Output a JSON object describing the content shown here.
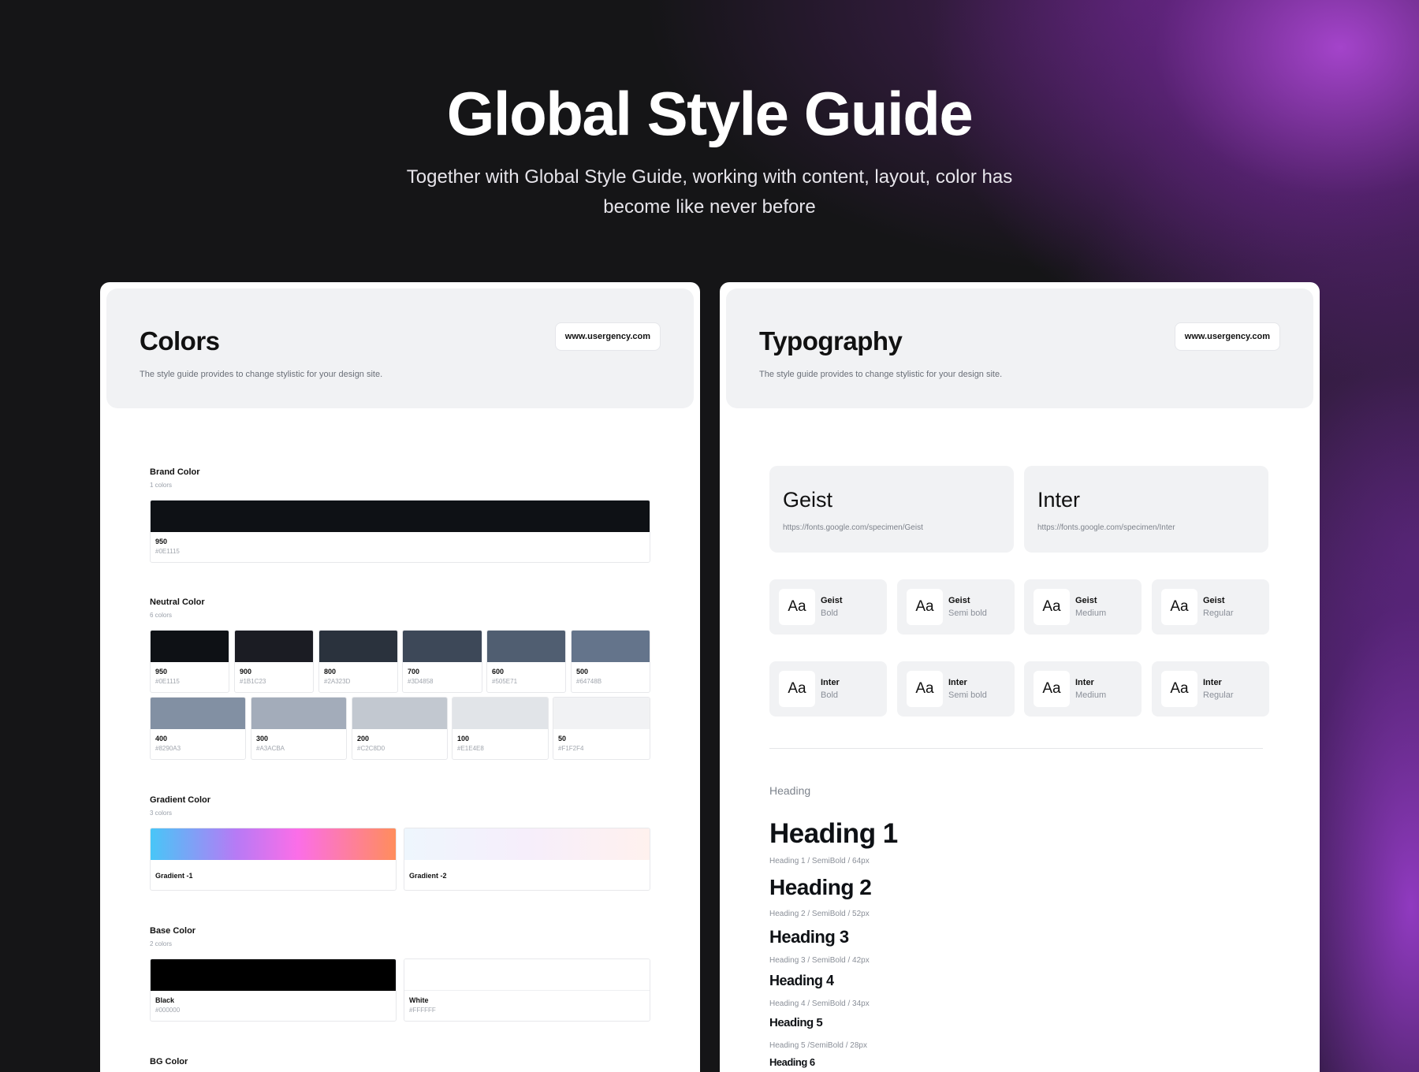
{
  "hero": {
    "title": "Global Style Guide",
    "subtitle": "Together with Global Style Guide, working with content, layout, color has become like never before"
  },
  "colors_panel": {
    "title": "Colors",
    "description": "The style guide provides to change stylistic for your design site.",
    "url_label": "www.usergency.com",
    "brand": {
      "title": "Brand Color",
      "count": "1 colors",
      "swatches": [
        {
          "name": "950",
          "hex": "#0E1115",
          "color": "#0E1115"
        }
      ]
    },
    "neutral": {
      "title": "Neutral Color",
      "count": "6 colors",
      "row1": [
        {
          "name": "950",
          "hex": "#0E1115",
          "color": "#0E1115"
        },
        {
          "name": "900",
          "hex": "#1B1C23",
          "color": "#1B1C23"
        },
        {
          "name": "800",
          "hex": "#2A323D",
          "color": "#2A323D"
        },
        {
          "name": "700",
          "hex": "#3D4858",
          "color": "#3D4858"
        },
        {
          "name": "600",
          "hex": "#505E71",
          "color": "#505E71"
        },
        {
          "name": "500",
          "hex": "#64748B",
          "color": "#64748B"
        }
      ],
      "row2": [
        {
          "name": "400",
          "hex": "#8290A3",
          "color": "#8290A3"
        },
        {
          "name": "300",
          "hex": "#A3ACBA",
          "color": "#A3ACBA"
        },
        {
          "name": "200",
          "hex": "#C2C8D0",
          "color": "#C2C8D0"
        },
        {
          "name": "100",
          "hex": "#E1E4E8",
          "color": "#E1E4E8"
        },
        {
          "name": "50",
          "hex": "#F1F2F4",
          "color": "#F1F2F4"
        }
      ]
    },
    "gradient": {
      "title": "Gradient Color",
      "count": "3 colors",
      "swatches": [
        {
          "name": "Gradient -1",
          "css": "linear-gradient(90deg,#48C6F7 0%,#B77AF5 35%,#FB6EE8 60%,#FF8D5C 100%)"
        },
        {
          "name": "Gradient -2",
          "css": "linear-gradient(90deg,#EEF6FD 0%,#F6EEFB 50%,#FFF1EE 100%)"
        }
      ]
    },
    "base": {
      "title": "Base Color",
      "count": "2 colors",
      "swatches": [
        {
          "name": "Black",
          "hex": "#000000",
          "color": "#000000"
        },
        {
          "name": "White",
          "hex": "#FFFFFF",
          "color": "#FFFFFF"
        }
      ]
    },
    "bg": {
      "title": "BG Color"
    }
  },
  "typography_panel": {
    "title": "Typography",
    "description": "The style guide provides to change stylistic for your design site.",
    "url_label": "www.usergency.com",
    "fonts": [
      {
        "name": "Geist",
        "url": "https://fonts.google.com/specimen/Geist"
      },
      {
        "name": "Inter",
        "url": "https://fonts.google.com/specimen/Inter"
      }
    ],
    "weights_geist": [
      {
        "aa": "Aa",
        "font": "Geist",
        "weight": "Bold"
      },
      {
        "aa": "Aa",
        "font": "Geist",
        "weight": "Semi bold"
      },
      {
        "aa": "Aa",
        "font": "Geist",
        "weight": "Medium"
      },
      {
        "aa": "Aa",
        "font": "Geist",
        "weight": "Regular"
      }
    ],
    "weights_inter": [
      {
        "aa": "Aa",
        "font": "Inter",
        "weight": "Bold"
      },
      {
        "aa": "Aa",
        "font": "Inter",
        "weight": "Semi bold"
      },
      {
        "aa": "Aa",
        "font": "Inter",
        "weight": "Medium"
      },
      {
        "aa": "Aa",
        "font": "Inter",
        "weight": "Regular"
      }
    ],
    "heading_section_label": "Heading",
    "headings": [
      {
        "text": "Heading 1",
        "meta": "Heading 1 / SemiBold / 64px"
      },
      {
        "text": "Heading 2",
        "meta": "Heading 2 / SemiBold / 52px"
      },
      {
        "text": "Heading 3",
        "meta": "Heading 3 / SemiBold / 42px"
      },
      {
        "text": "Heading 4",
        "meta": "Heading 4 / SemiBold / 34px"
      },
      {
        "text": "Heading 5",
        "meta": "Heading 5 /SemiBold / 28px"
      },
      {
        "text": "Heading 6",
        "meta": ""
      }
    ]
  }
}
